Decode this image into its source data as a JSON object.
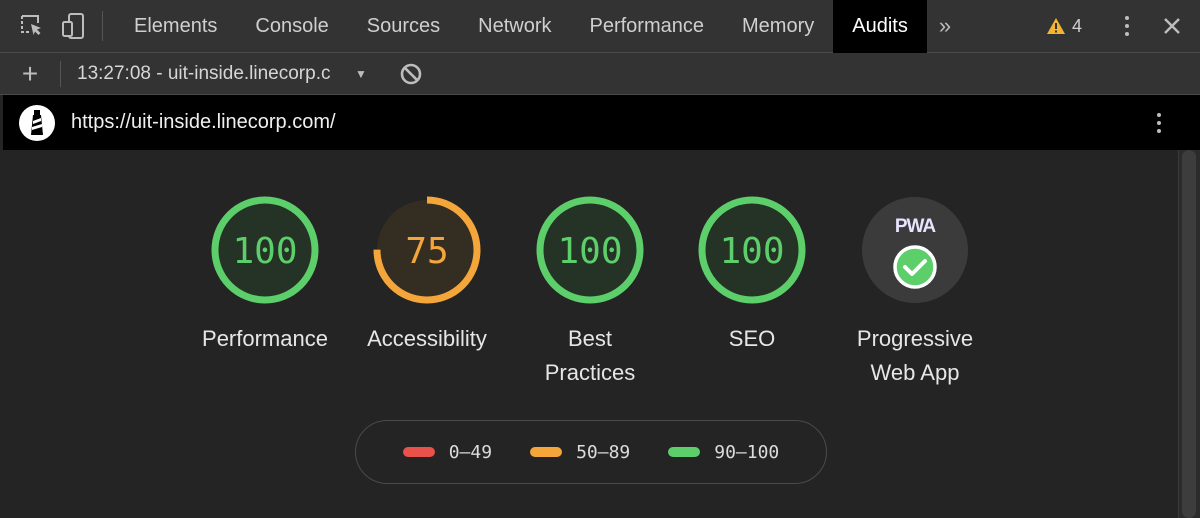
{
  "tabbar": {
    "tabs": [
      "Elements",
      "Console",
      "Sources",
      "Network",
      "Performance",
      "Memory",
      "Audits"
    ],
    "active_tab": "Audits",
    "warning_count": "4"
  },
  "toolbar": {
    "report_label": "13:27:08 - uit-inside.linecorp.c"
  },
  "urlbar": {
    "url": "https://uit-inside.linecorp.com/"
  },
  "categories": [
    {
      "score": "100",
      "label": "Performance",
      "color": "#5ccf6b"
    },
    {
      "score": "75",
      "label": "Accessibility",
      "color": "#f4a63a"
    },
    {
      "score": "100",
      "label": "Best Practices",
      "color": "#5ccf6b"
    },
    {
      "score": "100",
      "label": "SEO",
      "color": "#5ccf6b"
    }
  ],
  "pwa": {
    "badge": "PWA",
    "label": "Progressive Web App"
  },
  "legend": [
    {
      "range": "0–49",
      "color": "#e9514b"
    },
    {
      "range": "50–89",
      "color": "#f4a63a"
    },
    {
      "range": "90–100",
      "color": "#5ccf6b"
    }
  ]
}
